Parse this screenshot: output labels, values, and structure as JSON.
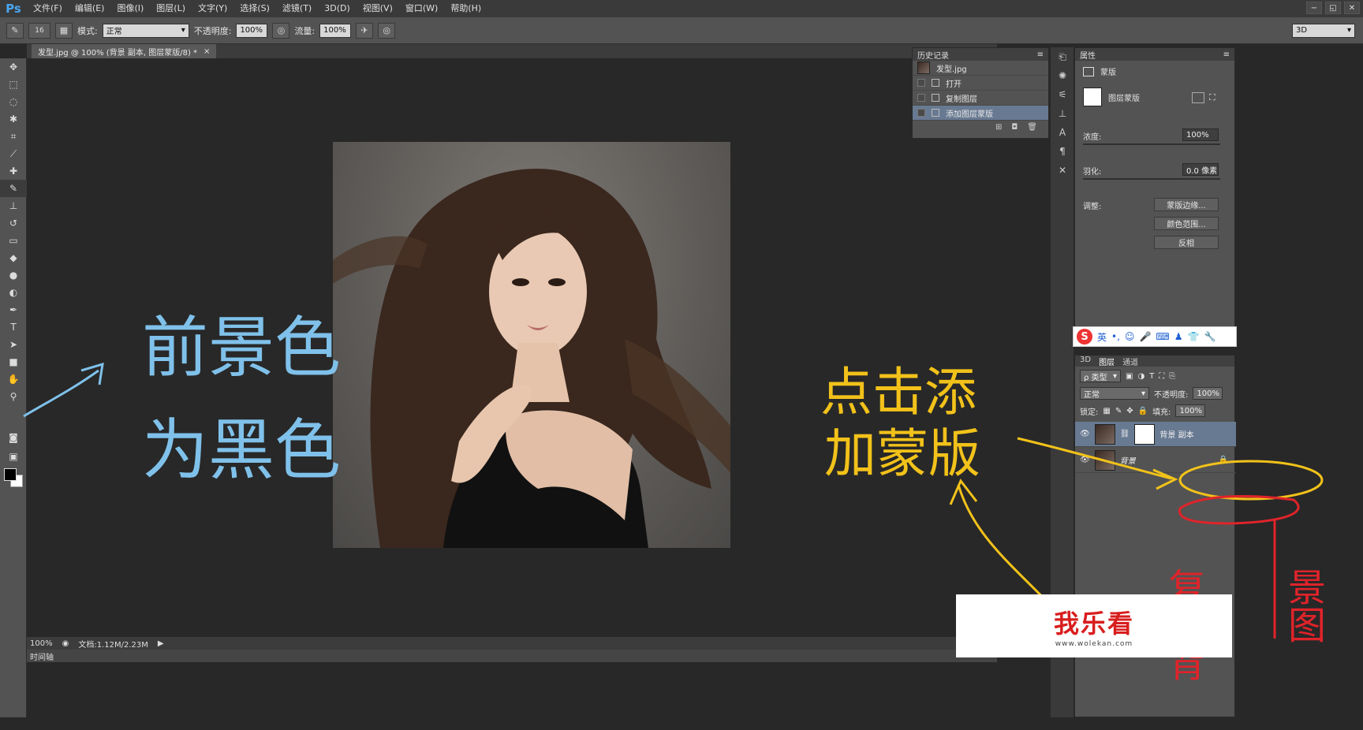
{
  "app": {
    "logo": "Ps"
  },
  "menu": [
    "文件(F)",
    "编辑(E)",
    "图像(I)",
    "图层(L)",
    "文字(Y)",
    "选择(S)",
    "滤镜(T)",
    "3D(D)",
    "视图(V)",
    "窗口(W)",
    "帮助(H)"
  ],
  "window_controls": [
    "−",
    "◱",
    "✕"
  ],
  "options": {
    "brush_size": "16",
    "mode_label": "模式:",
    "mode_value": "正常",
    "opacity_label": "不透明度:",
    "opacity_value": "100%",
    "flow_label": "流量:",
    "flow_value": "100%",
    "workspace": "3D"
  },
  "document": {
    "tab_title": "发型.jpg @ 100% (背景 副本, 图层蒙版/8) *",
    "close": "×",
    "zoom": "100%",
    "doc_size": "文档:1.12M/2.23M",
    "timeline": "时间轴"
  },
  "history": {
    "title": "历史记录",
    "snapshot": "发型.jpg",
    "items": [
      {
        "label": "打开"
      },
      {
        "label": "复制图层"
      },
      {
        "label": "添加图层蒙版"
      }
    ]
  },
  "properties": {
    "title": "属性",
    "mask_header": "蒙版",
    "mask_type": "图层蒙版",
    "density_label": "浓度:",
    "density_value": "100%",
    "feather_label": "羽化:",
    "feather_value": "0.0 像素",
    "adjust_label": "调整:",
    "btn_mask_edge": "蒙版边缘...",
    "btn_color_range": "颜色范围...",
    "btn_invert": "反相"
  },
  "ime": {
    "lang": "英"
  },
  "layers": {
    "tabs": [
      "3D",
      "图层",
      "通道"
    ],
    "filter_label": "ρ 类型",
    "blend_mode": "正常",
    "opacity_label": "不透明度:",
    "opacity_value": "100%",
    "lock_label": "锁定:",
    "fill_label": "填充:",
    "fill_value": "100%",
    "items": [
      {
        "name": "背景 副本"
      },
      {
        "name": "背景"
      }
    ]
  },
  "annotations": {
    "blue_line1": "前景色",
    "blue_line2": "为黑色",
    "yellow_line1": "点击添",
    "yellow_line2": "加蒙版",
    "red_line1": "复制背",
    "red_line2": "景图"
  },
  "colors": {
    "blue_ink": "#7fc1ea",
    "yellow_ink": "#f2c21a",
    "red_ink": "#e0232a"
  },
  "watermark": {
    "title": "我乐看",
    "url": "www.wolekan.com"
  }
}
